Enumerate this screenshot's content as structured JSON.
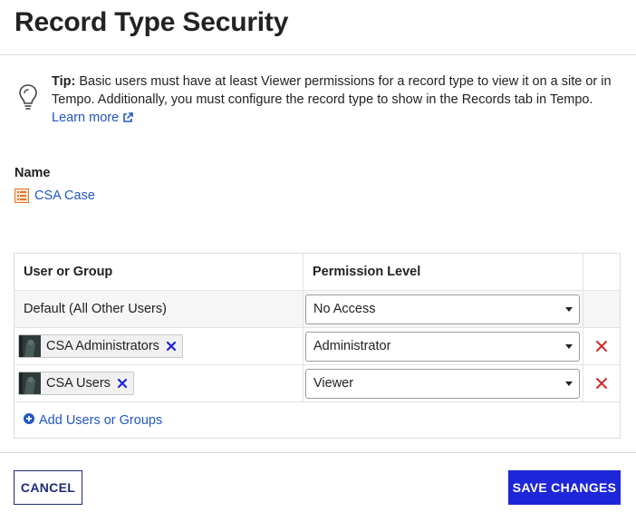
{
  "dialog": {
    "title": "Record Type Security"
  },
  "tip": {
    "label": "Tip:",
    "text": " Basic users must have at least Viewer permissions for a record type to view it on a site or in Tempo. Additionally, you must configure the record type to show in the Records tab in Tempo.",
    "learn_more": "Learn more"
  },
  "name_section": {
    "label": "Name",
    "record_type": "CSA Case"
  },
  "table": {
    "headers": {
      "user_or_group": "User or Group",
      "permission_level": "Permission Level"
    },
    "default_row": {
      "label": "Default (All Other Users)",
      "permission": "No Access"
    },
    "rows": [
      {
        "group": "CSA Administrators",
        "permission": "Administrator"
      },
      {
        "group": "CSA Users",
        "permission": "Viewer"
      }
    ],
    "add_link": "Add Users or Groups"
  },
  "buttons": {
    "cancel": "CANCEL",
    "save": "SAVE CHANGES"
  },
  "colors": {
    "link": "#2156c6",
    "primary": "#1e26d9",
    "danger": "#d12b2b",
    "record_icon": "#e0762d"
  },
  "icons": [
    "lightbulb-icon",
    "external-link-icon",
    "record-type-icon",
    "remove-pill-icon",
    "delete-row-icon",
    "add-circle-icon",
    "group-avatar"
  ]
}
